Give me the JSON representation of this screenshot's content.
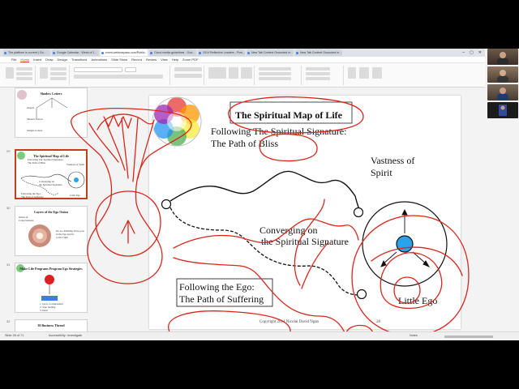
{
  "browser": {
    "tabs": [
      {
        "label": "The platform is current | Go..."
      },
      {
        "label": "Google Calendar - Week of 1..."
      },
      {
        "label": "event.webinarpass.com/Public..."
      },
      {
        "label": "Cloud media guidelines - Goo..."
      },
      {
        "label": "2014 Reflective Leaders - Pow..."
      },
      {
        "label": "New Tab Context Grounded in..."
      },
      {
        "label": "New Tab Context Grounded in..."
      }
    ]
  },
  "powerpoint": {
    "menu_tabs": [
      "File",
      "Home",
      "Insert",
      "Draw",
      "Design",
      "Transitions",
      "Animations",
      "Slide Show",
      "Record",
      "Review",
      "View",
      "Help",
      "Zoom PDF"
    ],
    "active_menu": "Home"
  },
  "thumbnails": [
    {
      "number": "",
      "title": "Shadow Letters",
      "lines": [
        "Angels",
        "Shadow Letters",
        "Sample Letters"
      ]
    },
    {
      "number": "29",
      "title": "The Spiritual Map of Life",
      "lines": [
        "Following The Spiritual Signature:",
        "The Path of Bliss",
        "Converging on",
        "the Spiritual Signature",
        "Following the Ego:",
        "The Path of Suffering",
        "Vastness of Spirit",
        "Little Ego"
      ]
    },
    {
      "number": "30",
      "title": "Layers of the Ego Onion",
      "lines": [
        "Onion of",
        "Consciousness",
        "Do too Kindling above you",
        "in the Ego and its",
        "to the Light"
      ]
    },
    {
      "number": "31",
      "title": "Make Life Programs Program Ego Strategies",
      "lines": [
        "1. Grow to understand",
        "2. Stop feeding",
        "3. Don't"
      ]
    },
    {
      "number": "32",
      "title": "30 Business Thread",
      "lines": []
    }
  ],
  "slide": {
    "title": "The Spiritual Map of Life",
    "bliss_line1": "Following The Spiritual Signature:",
    "bliss_line2": "The Path of Bliss",
    "vastness_line1": "Vastness of",
    "vastness_line2": "Spirit",
    "converging_line1": "Converging on",
    "converging_line2": "the Spiritual Signature",
    "ego_line1": "Following the Ego:",
    "ego_line2": "The Path of Suffering",
    "little_ego": "Little Ego",
    "copyright": "Copyright 2014 Nicolai David Ngan",
    "number": "28"
  },
  "status": {
    "left": "Slide 28 of 71",
    "accessibility": "Accessibility: Investigate",
    "notes": "Notes"
  },
  "colors": {
    "ink": "#d9261c",
    "accent": "#b7472a",
    "ego_dot": "#29a3ea"
  }
}
